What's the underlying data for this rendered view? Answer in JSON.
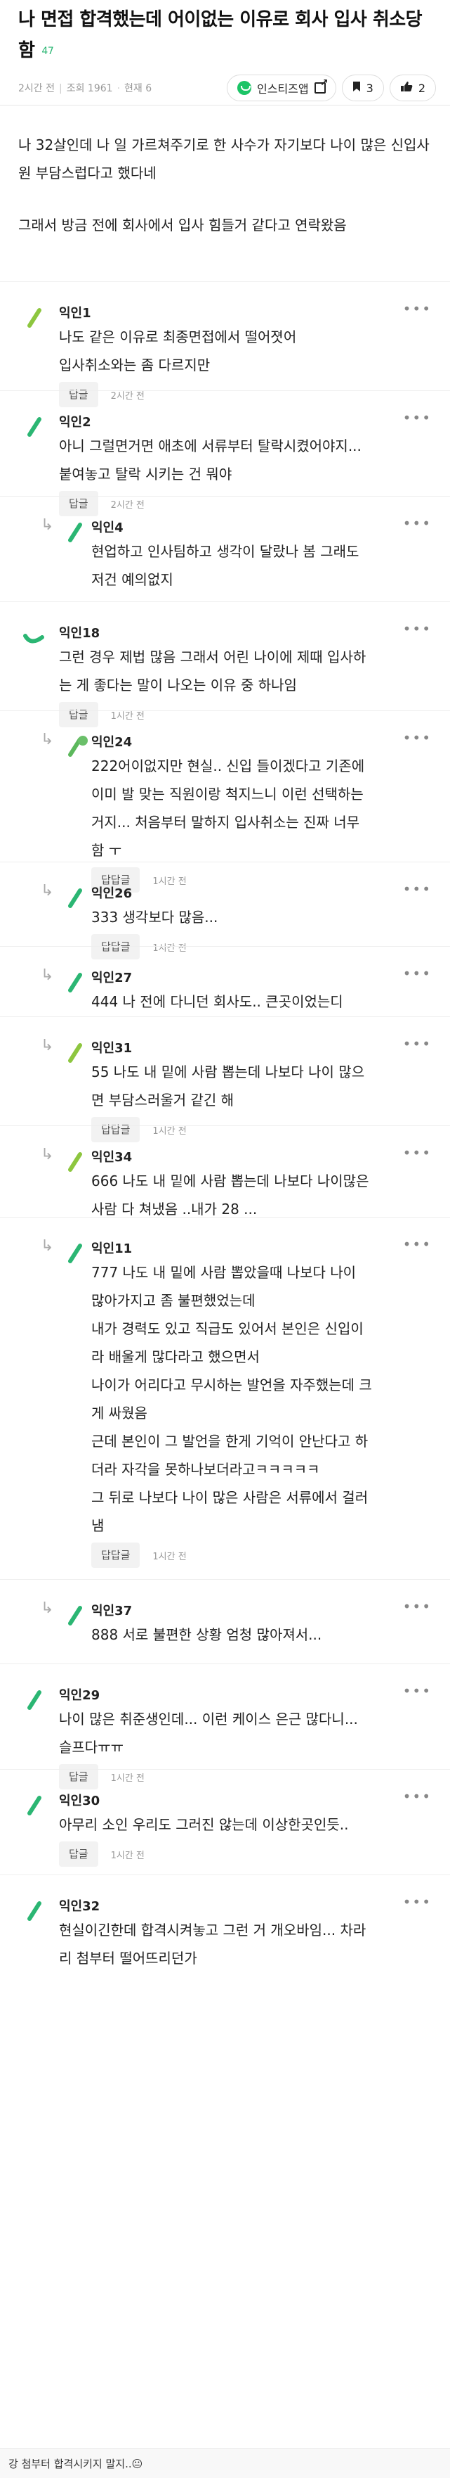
{
  "post": {
    "title": "나 면접 합격했는데 어이없는 이유로 회사 입사 취소당함",
    "comment_count": "47",
    "time": "2시간 전",
    "views": "조회 1961",
    "now": "현재 6",
    "insta_label": "인스티즈앱",
    "bookmark_count": "3",
    "like_count": "2",
    "body": [
      "나 32살인데 나 일 가르쳐주기로 한 사수가 자기보다 나이 많은 신입사원 부담스럽다고 했다네",
      "그래서 방금 전에 회사에서 입사 힘들거 같다고 연락왔음"
    ]
  },
  "ui": {
    "reply_label": "답글",
    "reply_reply_label": "답답글",
    "more": "•••"
  },
  "comments": [
    {
      "nick": "익인1",
      "text": "나도 같은 이유로 최종면접에서 떨어졋어\n입사취소와는 좀 다르지만",
      "time": "2시간 전",
      "color": "#8dc63f"
    },
    {
      "nick": "익인2",
      "text": "아니 그럴면거면 애초에 서류부터 탈락시켰어야지...\n붙여놓고 탈락 시키는 건 뭐야",
      "time": "2시간 전",
      "color": "#2bb673"
    },
    {
      "nick": "익인4",
      "text": "현업하고 인사팀하고 생각이 달랐나 봄 그래도\n저건 예의없지",
      "time": "",
      "color": "#2bb673"
    },
    {
      "nick": "익인18",
      "text": "그런 경우 제법 많음 그래서 어린 나이에 제때 입사하\n는 게 좋다는 말이 나오는 이유 중 하나임",
      "time": "1시간 전",
      "color": "#2bb673"
    },
    {
      "nick": "익인24",
      "text": "222어이없지만 현실.. 신입 들이겠다고 기존에\n이미 발 맞는 직원이랑 척지느니 이런 선택하는\n거지... 처음부터 말하지 입사취소는 진짜 너무\n함 ㅜ",
      "time": "1시간 전",
      "color": "#5cb85c"
    },
    {
      "nick": "익인26",
      "text": "333 생각보다 많음...",
      "time": "1시간 전",
      "color": "#2bb673"
    },
    {
      "nick": "익인27",
      "text": "444 나 전에 다니던 회사도.. 큰곳이었는디",
      "time": "",
      "color": "#2bb673"
    },
    {
      "nick": "익인31",
      "text": "55 나도 내 밑에 사람 뽑는데 나보다 나이 많으\n면 부담스러울거 같긴 해",
      "time": "1시간 전",
      "color": "#8dc63f"
    },
    {
      "nick": "익인34",
      "text": "666 나도 내 밑에 사람 뽑는데 나보다 나이많은\n사람 다 쳐냈음 ..내가 28 ...",
      "time": "",
      "color": "#8dc63f"
    },
    {
      "nick": "익인11",
      "text": "777 나도 내 밑에 사람 뽑았을때 나보다 나이\n많아가지고 좀 불편했었는데\n내가 경력도 있고 직급도 있어서 본인은 신입이\n라 배울게 많다라고 했으면서\n나이가 어리다고 무시하는 발언을 자주했는데 크\n게 싸웠음\n근데 본인이 그 발언을 한게 기억이 안난다고 하\n더라 자각을 못하나보더라고ㅋㅋㅋㅋㅋ\n그 뒤로 나보다 나이 많은 사람은 서류에서 걸러\n냄",
      "time": "1시간 전",
      "color": "#2bb673"
    },
    {
      "nick": "익인37",
      "text": "888 서로 불편한 상황 엄청 많아져서...",
      "time": "",
      "color": "#2bb673"
    },
    {
      "nick": "익인29",
      "text": "나이 많은 취준생인데... 이런 케이스 은근 많다니...\n슬프다ㅠㅠ",
      "time": "1시간 전",
      "color": "#2bb673"
    },
    {
      "nick": "익인30",
      "text": "아무리 소인 우리도 그러진 않는데 이상한곳인듯..",
      "time": "1시간 전",
      "color": "#2bb673"
    },
    {
      "nick": "익인32",
      "text": "현실이긴한데 합격시켜놓고 그런 거 개오바임... 차라\n리 첨부터 떨어뜨리던가",
      "time": "",
      "color": "#2bb673"
    }
  ],
  "footer": {
    "text": "강 첨부터 합격시키지 말지..😐"
  }
}
